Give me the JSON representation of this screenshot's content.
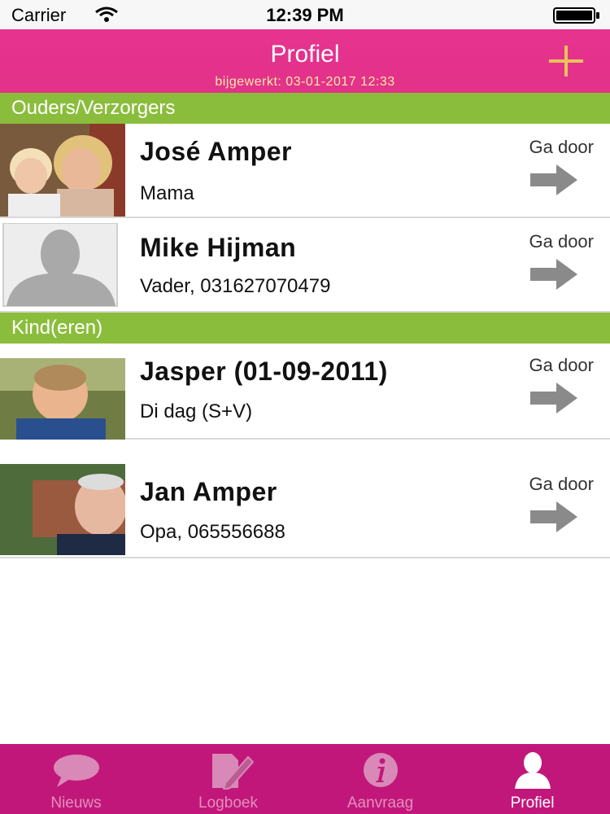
{
  "status_bar": {
    "carrier": "Carrier",
    "time": "12:39 PM"
  },
  "header": {
    "title": "Profiel",
    "subtitle": "bijgewerkt: 03-01-2017 12:33",
    "add_icon": "plus-icon"
  },
  "sections": [
    {
      "title": "Ouders/Verzorgers",
      "items": [
        {
          "name": "José Amper",
          "subtitle": "Mama",
          "action": "Ga door"
        },
        {
          "name": "Mike Hijman",
          "subtitle": "Vader, 031627070479",
          "action": "Ga door"
        }
      ]
    },
    {
      "title": "Kind(eren)",
      "items": [
        {
          "name": "Jasper (01-09-2011)",
          "subtitle": "Di dag (S+V)",
          "action": "Ga door"
        },
        {
          "name": "Jan Amper",
          "subtitle": "Opa, 065556688",
          "action": "Ga door"
        }
      ]
    }
  ],
  "tab_bar": {
    "tabs": [
      {
        "label": "Nieuws",
        "icon": "speech-bubble-icon"
      },
      {
        "label": "Logboek",
        "icon": "pencil-document-icon"
      },
      {
        "label": "Aanvraag",
        "icon": "info-icon"
      },
      {
        "label": "Profiel",
        "icon": "person-icon"
      }
    ],
    "active": "Profiel"
  },
  "colors": {
    "header": "#e6338f",
    "section": "#8bbd3c",
    "tab_bar": "#c2177a",
    "accent_plus": "#e7c35a",
    "subtitle": "#f7e9a7"
  }
}
